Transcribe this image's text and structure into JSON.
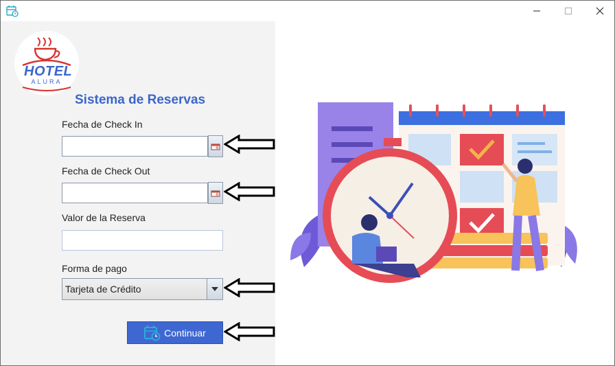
{
  "window": {
    "app_icon": "calendar-clock-icon",
    "controls": {
      "minimize": "minimize-icon",
      "maximize": "maximize-icon",
      "close": "close-icon"
    }
  },
  "logo": {
    "name": "hotel-alura-logo",
    "text": "HOTEL",
    "subtext": "ALURA"
  },
  "form": {
    "title": "Sistema de Reservas",
    "checkin_label": "Fecha de Check In",
    "checkin_value": "",
    "checkout_label": "Fecha de Check Out",
    "checkout_value": "",
    "valor_label": "Valor de la Reserva",
    "valor_value": "",
    "pago_label": "Forma de pago",
    "pago_selected": "Tarjeta de Crédito",
    "continue_label": "Continuar"
  },
  "colors": {
    "accent": "#3f67d1",
    "title": "#3b66c9",
    "panel": "#f3f3f3"
  }
}
